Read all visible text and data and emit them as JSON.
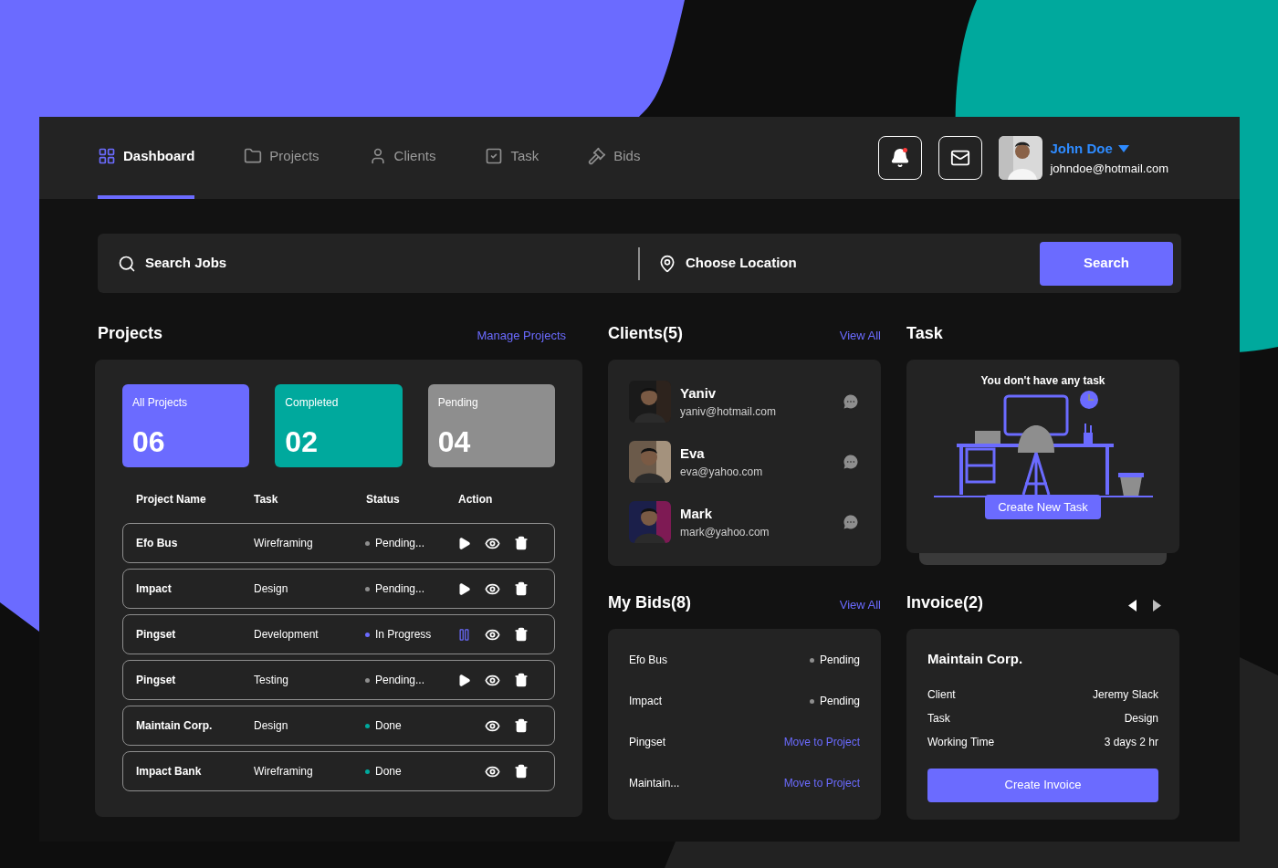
{
  "nav": {
    "tabs": [
      {
        "label": "Dashboard",
        "kind": "grid",
        "selected": true
      },
      {
        "label": "Projects",
        "kind": "folder",
        "selected": false
      },
      {
        "label": "Clients",
        "kind": "user",
        "selected": false
      },
      {
        "label": "Task",
        "kind": "check",
        "selected": false
      },
      {
        "label": "Bids",
        "kind": "gavel",
        "selected": false
      }
    ],
    "notifications": {
      "unread": true
    },
    "user": {
      "name": "John Doe",
      "email": "johndoe@hotmail.com"
    }
  },
  "search": {
    "jobs_placeholder": "Search Jobs",
    "location_placeholder": "Choose Location",
    "button": "Search"
  },
  "projects": {
    "title": "Projects",
    "link": "Manage Projects",
    "stats": [
      {
        "label": "All Projects",
        "value": "06",
        "color": "#6b6bff"
      },
      {
        "label": "Completed",
        "value": "02",
        "color": "#00a99d"
      },
      {
        "label": "Pending",
        "value": "04",
        "color": "#8e8e8e"
      }
    ],
    "columns": [
      "Project Name",
      "Task",
      "Status",
      "Action"
    ],
    "rows": [
      {
        "name": "Efo Bus",
        "task": "Wireframing",
        "status": "Pending...",
        "kind": "pending"
      },
      {
        "name": "Impact",
        "task": "Design",
        "status": "Pending...",
        "kind": "pending"
      },
      {
        "name": "Pingset",
        "task": "Development",
        "status": "In Progress",
        "kind": "progress"
      },
      {
        "name": "Pingset",
        "task": "Testing",
        "status": "Pending...",
        "kind": "pending"
      },
      {
        "name": "Maintain Corp.",
        "task": "Design",
        "status": "Done",
        "kind": "done"
      },
      {
        "name": "Impact Bank",
        "task": "Wireframing",
        "status": "Done",
        "kind": "done"
      }
    ]
  },
  "clients": {
    "title": "Clients(5)",
    "link": "View All",
    "items": [
      {
        "name": "Yaniv",
        "email": "yaniv@hotmail.com"
      },
      {
        "name": "Eva",
        "email": "eva@yahoo.com"
      },
      {
        "name": "Mark",
        "email": "mark@yahoo.com"
      }
    ]
  },
  "task": {
    "title": "Task",
    "message": "You don't have any task",
    "button": "Create New Task"
  },
  "bids": {
    "title": "My Bids(8)",
    "link": "View All",
    "items": [
      {
        "name": "Efo Bus",
        "status": "Pending",
        "kind": "status"
      },
      {
        "name": "Impact",
        "status": "Pending",
        "kind": "status"
      },
      {
        "name": "Pingset",
        "status": "Move to Project",
        "kind": "action"
      },
      {
        "name": "Maintain...",
        "status": "Move to Project",
        "kind": "action"
      }
    ]
  },
  "invoice": {
    "title": "Invoice(2)",
    "company": "Maintain Corp.",
    "fields": [
      {
        "label": "Client",
        "value": "Jeremy Slack"
      },
      {
        "label": "Task",
        "value": "Design"
      },
      {
        "label": "Working Time",
        "value": "3 days 2 hr"
      }
    ],
    "button": "Create Invoice"
  }
}
